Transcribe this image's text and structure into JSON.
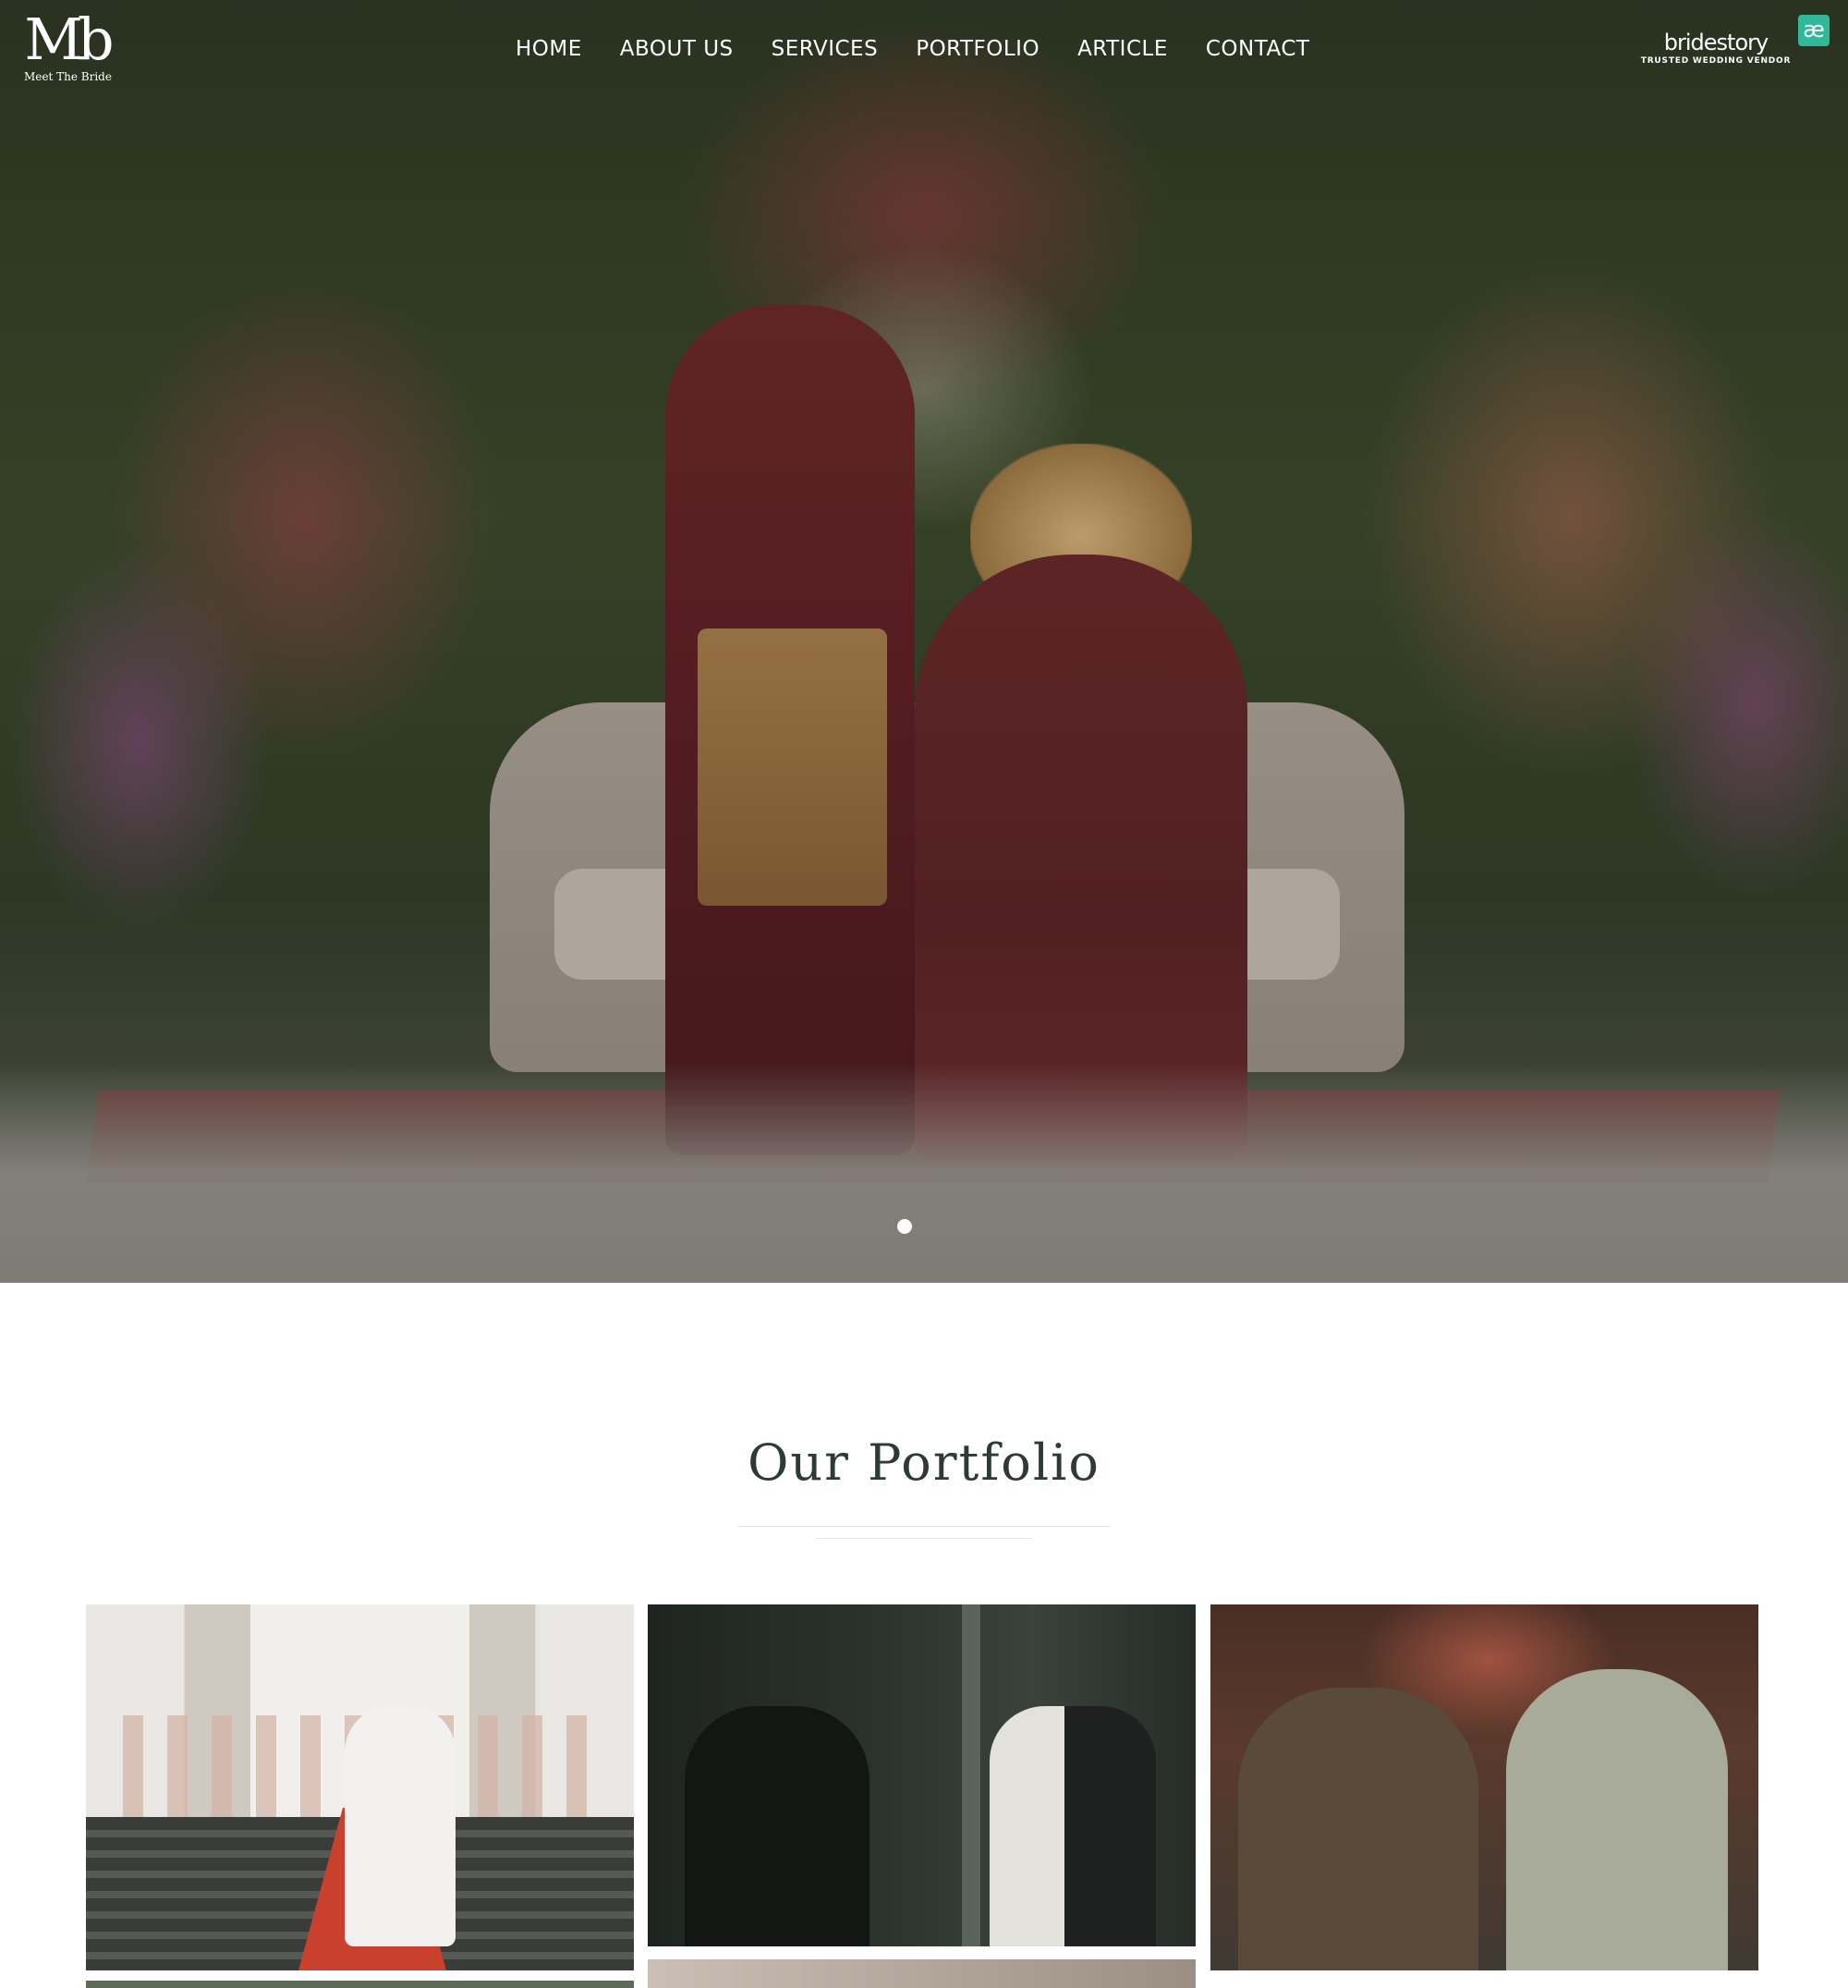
{
  "header": {
    "logo_mark": "Mb",
    "logo_text": "Meet The Bride",
    "nav": [
      "HOME",
      "ABOUT US",
      "SERVICES",
      "PORTFOLIO",
      "ARTICLE",
      "CONTACT"
    ],
    "bridestory_name": "bridestory",
    "bridestory_tag": "TRUSTED WEDDING VENDOR",
    "ae_badge": "æ"
  },
  "hero": {
    "slider_active_index": 0
  },
  "portfolio": {
    "title": "Our Portfolio"
  },
  "colors": {
    "title_text": "#2d3b33",
    "nav_text": "#ffffff",
    "ae_badge": "#2fb89a"
  }
}
